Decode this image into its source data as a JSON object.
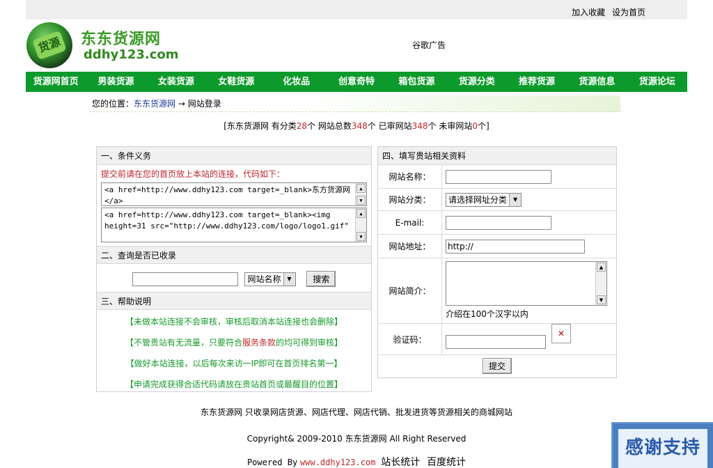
{
  "top_links": [
    "加入收藏",
    "设为首页"
  ],
  "logo": {
    "title": "东东货源网",
    "url": "ddhy123.com",
    "badge": "货源"
  },
  "ad_text": "谷歌广告",
  "nav": [
    "货源网首页",
    "男装货源",
    "女装货源",
    "女鞋货源",
    "化妆品",
    "创意奇特",
    "箱包货源",
    "货源分类",
    "推荐货源",
    "货源信息",
    "货源论坛"
  ],
  "breadcrumb": {
    "prefix": "您的位置：",
    "home": "东东货源网",
    "arrow": "→",
    "current": "网站登录"
  },
  "stats": {
    "open": "[东东货源网 有分类",
    "categories": "28",
    "t1": "个 网站总数",
    "total": "348",
    "t2": "个 已审网站",
    "approved": "348",
    "t3": "个 未审网站",
    "pending": "0",
    "close": "个]"
  },
  "left_panel": {
    "section1_title": "一、条件义务",
    "note": "提交前请在您的首页放上本站的连接，代码如下：",
    "code1": "<a href=http://www.ddhy123.com target=_blank>东方货源网</a>",
    "code2": "<a href=http://www.ddhy123.com target=_blank><img height=31 src=\"http://www.ddhy123.com/logo/logo1.gif\"",
    "section2_title": "二、查询是否已收录",
    "search_select": "网站名称",
    "search_button": "搜索",
    "section3_title": "三、帮助说明",
    "help1": "【未做本站连接不会审核，审核后取消本站连接也会删除】",
    "help2_a": "【不管贵站有无流量，只要符合",
    "help2_b": "服务条款",
    "help2_c": "的均可得到审核】",
    "help3": "【做好本站连接，以后每次来访一IP即可在首页排名第一】",
    "help4": "【申请完成获得合适代码请放在贵站首页或最醒目的位置】"
  },
  "right_panel": {
    "title": "四、填写贵站相关资料",
    "labels": [
      "网站名称：",
      "网站分类：",
      "E-mail:",
      "网站地址：",
      "网站简介：",
      "验证码："
    ],
    "category_select": "请选择网址分类",
    "url_value": "http://",
    "intro_hint": "介绍在100个汉字以内",
    "submit": "提交"
  },
  "footer": {
    "line1": "东东货源网 只收录网店货源、网店代理、网店代销、批发进货等货源相关的商城网站",
    "line2": "Copyright& 2009-2010 东东货源网 All Right Reserved",
    "powered": "Powered By",
    "site": "www.ddhy123.com",
    "stat1": "站长统计",
    "stat2": "百度统计"
  },
  "thanks": "感谢支持"
}
